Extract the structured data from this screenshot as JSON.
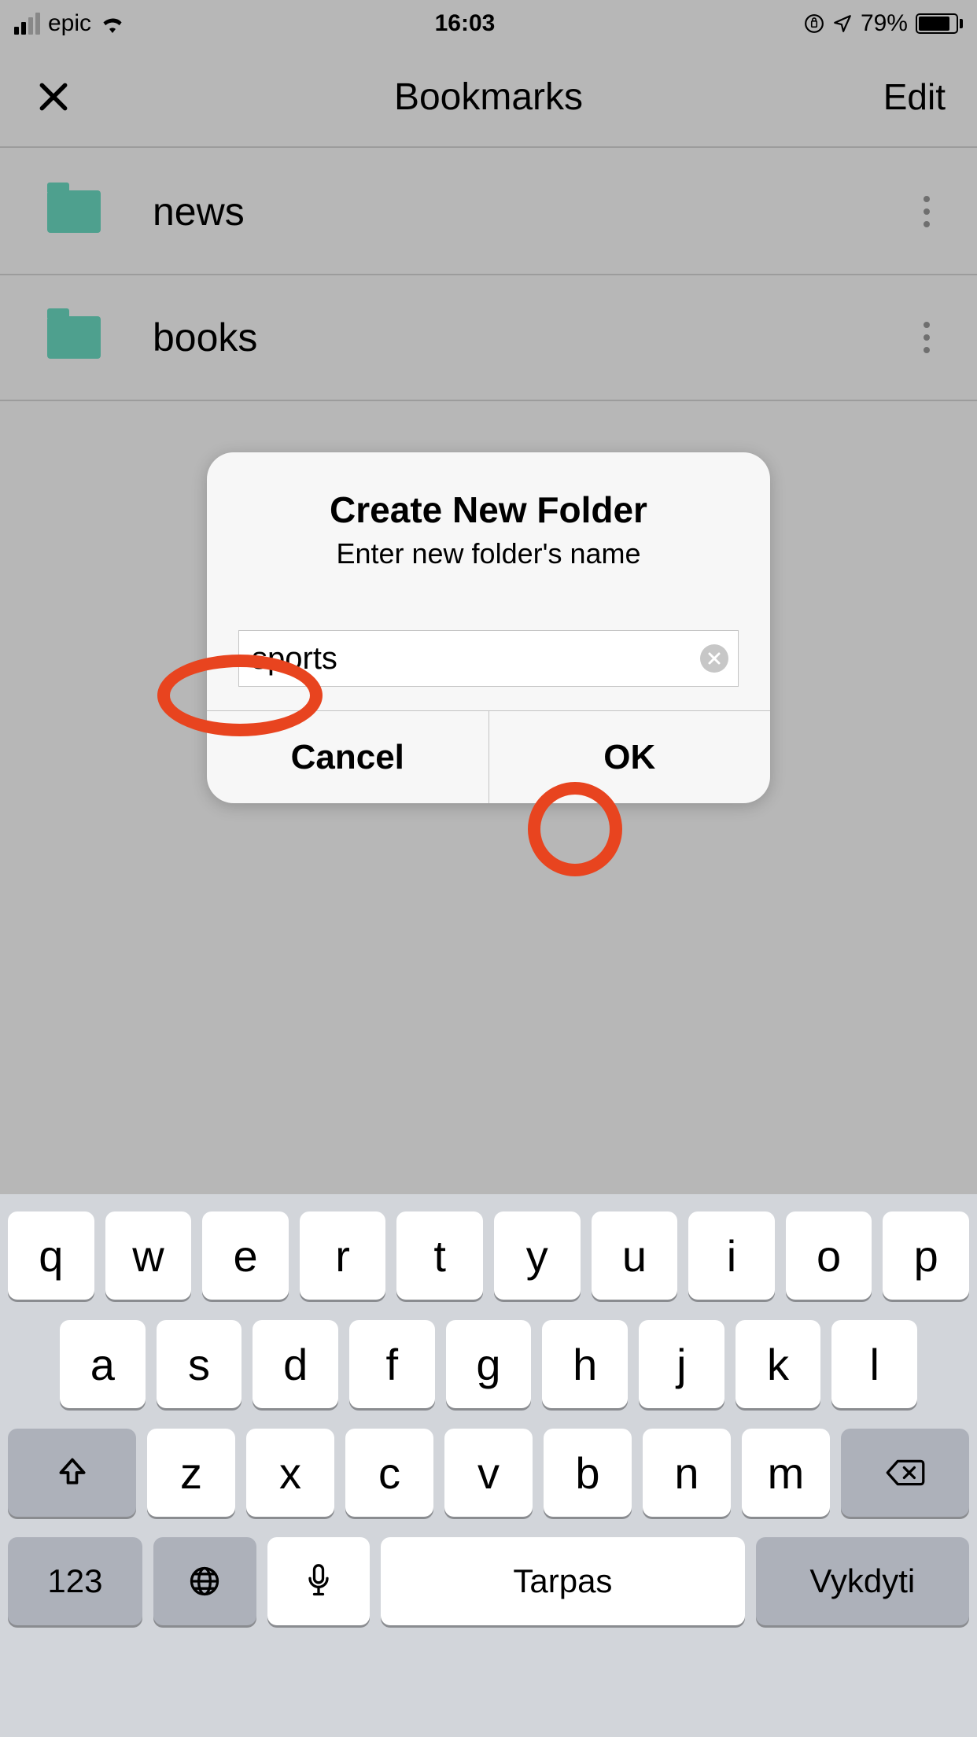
{
  "status": {
    "carrier": "epic",
    "time": "16:03",
    "battery_pct": "79%"
  },
  "nav": {
    "title": "Bookmarks",
    "edit": "Edit"
  },
  "folders": [
    {
      "name": "news"
    },
    {
      "name": "books"
    }
  ],
  "alert": {
    "title": "Create New Folder",
    "message": "Enter new folder's name",
    "input_value": "sports",
    "cancel": "Cancel",
    "ok": "OK"
  },
  "keyboard": {
    "row1": [
      "q",
      "w",
      "e",
      "r",
      "t",
      "y",
      "u",
      "i",
      "o",
      "p"
    ],
    "row2": [
      "a",
      "s",
      "d",
      "f",
      "g",
      "h",
      "j",
      "k",
      "l"
    ],
    "row3": [
      "z",
      "x",
      "c",
      "v",
      "b",
      "n",
      "m"
    ],
    "numbers": "123",
    "space": "Tarpas",
    "action": "Vykdyti"
  }
}
